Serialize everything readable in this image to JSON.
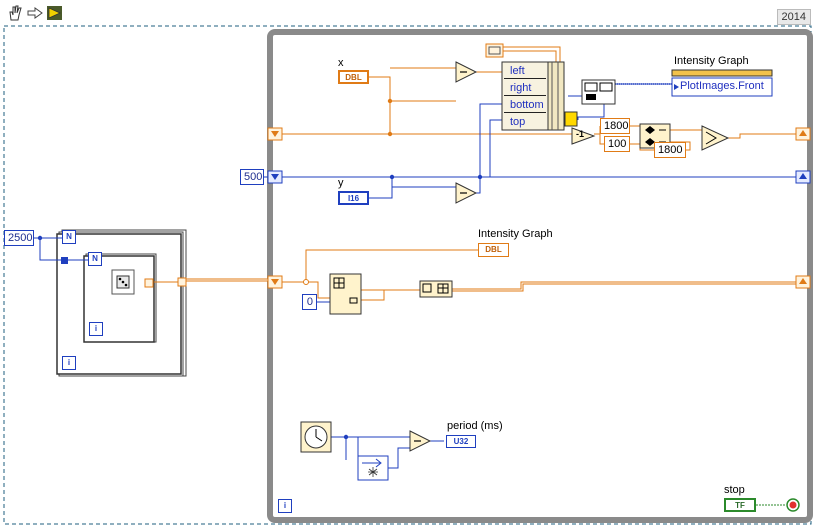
{
  "toolbar": {
    "run_icon": "run-arrow-icon",
    "version_badge": "2014"
  },
  "outer_loop": {
    "count_value": "2500",
    "count_terminal": "N",
    "iteration_terminal": "i"
  },
  "inner_loop": {
    "count_terminal": "N",
    "iteration_terminal": "i",
    "random_node_icon": "dice-icon"
  },
  "while_loop": {
    "iteration_terminal": "i",
    "shift_register_value": "500"
  },
  "controls": {
    "x_label": "x",
    "x_type": "DBL",
    "y_label": "y",
    "y_type": "I16",
    "stop_label": "stop",
    "stop_type": "TF"
  },
  "property_node": {
    "title": "Intensity Graph",
    "property": "PlotImages.Front",
    "items": [
      "left",
      "right",
      "bottom",
      "top"
    ]
  },
  "intensity_terminal": {
    "label": "Intensity Graph",
    "type": "DBL"
  },
  "constants": {
    "width_a": "1800",
    "height_a": "100",
    "width_b": "1800",
    "index_zero": "0",
    "minus_one": "-1"
  },
  "timing": {
    "label": "period (ms)",
    "type": "U32"
  },
  "colors": {
    "orange_wire": "#e07b16",
    "blue_wire": "#1f3fbf",
    "loop_border": "#8a8a8a",
    "stop_green": "#2b8a2b"
  }
}
